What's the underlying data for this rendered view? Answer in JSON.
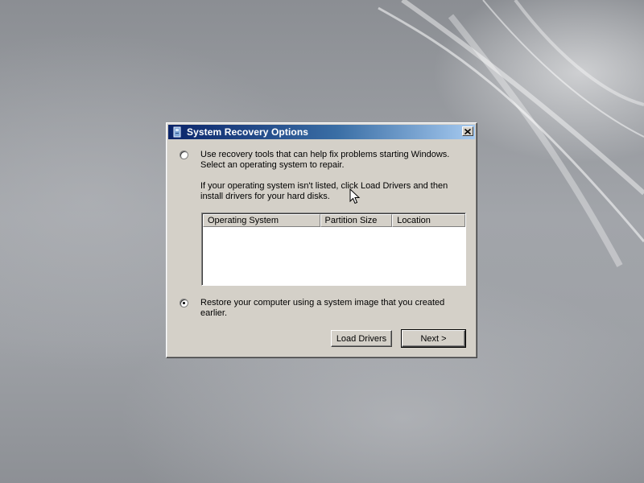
{
  "window": {
    "title": "System Recovery Options",
    "icon": "computer-repair-icon",
    "close_icon": "close-icon"
  },
  "options": {
    "recovery_tools": {
      "selected": false,
      "line1": "Use recovery tools that can help fix problems starting Windows.",
      "line2": "Select an operating system to repair."
    },
    "driver_note": {
      "line1": "If your operating system isn't listed, click Load Drivers and then",
      "line2": "install drivers for your hard disks."
    },
    "system_image": {
      "selected": true,
      "line1": "Restore your computer using a system image that you created",
      "line2": "earlier."
    }
  },
  "os_list": {
    "columns": [
      "Operating System",
      "Partition Size",
      "Location"
    ],
    "rows": []
  },
  "buttons": {
    "load_drivers": "Load Drivers",
    "next": "Next >"
  },
  "colors": {
    "titlebar_start": "#0a246a",
    "titlebar_end": "#a6caf0",
    "dialog_face": "#d4d0c8"
  }
}
